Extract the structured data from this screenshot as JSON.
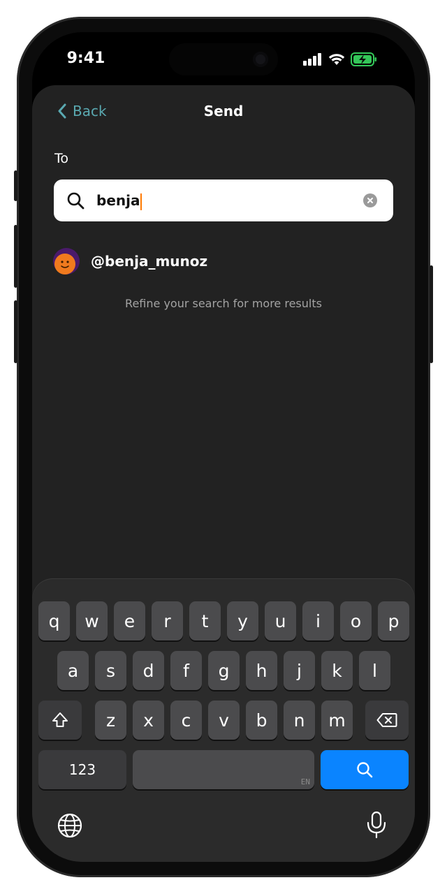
{
  "status_bar": {
    "time": "9:41",
    "icons": [
      "signal-icon",
      "wifi-icon",
      "battery-charging-icon"
    ],
    "battery_color": "#34c759"
  },
  "nav": {
    "back_label": "Back",
    "title": "Send",
    "accent_color": "#5aa9b1"
  },
  "recipient": {
    "label": "To",
    "search_value": "benja",
    "results": [
      {
        "handle": "@benja_munoz"
      }
    ],
    "hint": "Refine your search for more results"
  },
  "keyboard": {
    "row1": [
      "q",
      "w",
      "e",
      "r",
      "t",
      "y",
      "u",
      "i",
      "o",
      "p"
    ],
    "row2": [
      "a",
      "s",
      "d",
      "f",
      "g",
      "h",
      "j",
      "k",
      "l"
    ],
    "row3": [
      "z",
      "x",
      "c",
      "v",
      "b",
      "n",
      "m"
    ],
    "numbers_label": "123",
    "space_language": "EN",
    "action_color": "#0a84ff"
  }
}
